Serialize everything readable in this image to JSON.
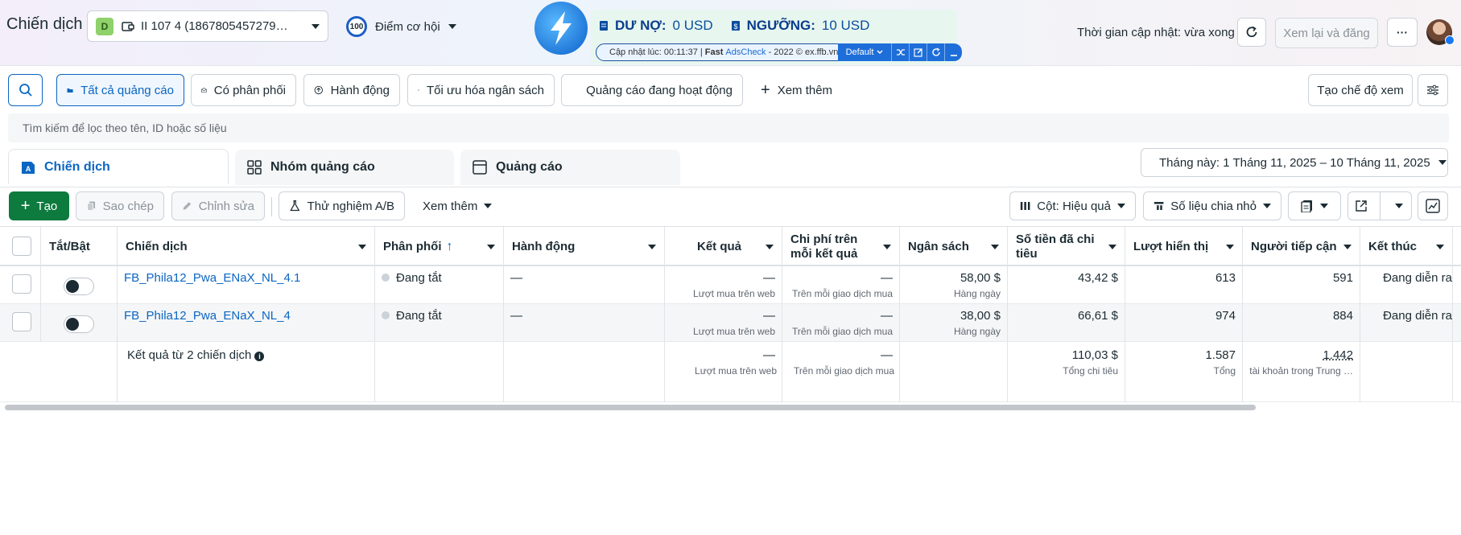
{
  "header": {
    "title": "Chiến dịch",
    "account_badge": "D",
    "account_name": "II 107 4 (1867805457279…",
    "opportunity_score": "100",
    "opportunity_label": "Điểm cơ hội",
    "update_time": "Thời gian cập nhật: vừa xong",
    "review_publish": "Xem lại và đăng",
    "more": "···"
  },
  "extension": {
    "debt_label": "DƯ NỢ:",
    "debt_value": "0 USD",
    "threshold_label": "NGƯỠNG:",
    "threshold_value": "10 USD",
    "updated_prefix": "Cập nhật lúc: 00:11:37 |",
    "fast": "Fast",
    "adscheck": "AdsCheck",
    "copyright": "- 2022 © ex.ffb.vn",
    "mode": "Default"
  },
  "filters": {
    "all_ads": "Tất cả quảng cáo",
    "has_delivery": "Có phân phối",
    "actions": "Hành động",
    "budget_opt": "Tối ưu hóa ngân sách",
    "active_ads": "Quảng cáo đang hoạt động",
    "see_more": "Xem thêm",
    "create_view": "Tạo chế độ xem"
  },
  "search": {
    "placeholder": "Tìm kiếm để lọc theo tên, ID hoặc số liệu"
  },
  "tabs": {
    "campaigns": "Chiến dịch",
    "adsets": "Nhóm quảng cáo",
    "ads": "Quảng cáo",
    "date_range": "Tháng này: 1 Tháng 11, 2025 – 10 Tháng 11, 2025"
  },
  "toolbar": {
    "create": "Tạo",
    "copy": "Sao chép",
    "edit": "Chỉnh sửa",
    "ab_test": "Thử nghiệm A/B",
    "see_more": "Xem thêm",
    "columns": "Cột: Hiệu quả",
    "breakdown": "Số liệu chia nhỏ"
  },
  "table": {
    "headers": {
      "toggle": "Tắt/Bật",
      "campaign": "Chiến dịch",
      "delivery": "Phân phối",
      "actions": "Hành động",
      "results": "Kết quả",
      "cost_per_result": "Chi phí trên mỗi kết quả",
      "budget": "Ngân sách",
      "amount_spent": "Số tiền đã chi tiêu",
      "impressions": "Lượt hiển thị",
      "reach": "Người tiếp cận",
      "ends": "Kết thúc"
    },
    "rows": [
      {
        "name": "FB_Phila12_Pwa_ENaX_NL_4.1",
        "delivery": "Đang tắt",
        "actions": "—",
        "results": "—",
        "results_sub": "Lượt mua trên web",
        "cost": "—",
        "cost_sub": "Trên mỗi giao dịch mua",
        "budget": "58,00 $",
        "budget_sub": "Hàng ngày",
        "spent": "43,42 $",
        "impressions": "613",
        "reach": "591",
        "ends": "Đang diễn ra"
      },
      {
        "name": "FB_Phila12_Pwa_ENaX_NL_4",
        "delivery": "Đang tắt",
        "actions": "—",
        "results": "—",
        "results_sub": "Lượt mua trên web",
        "cost": "—",
        "cost_sub": "Trên mỗi giao dịch mua",
        "budget": "38,00 $",
        "budget_sub": "Hàng ngày",
        "spent": "66,61 $",
        "impressions": "974",
        "reach": "884",
        "ends": "Đang diễn ra"
      }
    ],
    "summary": {
      "label": "Kết quả từ 2 chiến dịch",
      "results": "—",
      "results_sub": "Lượt mua trên web",
      "cost": "—",
      "cost_sub": "Trên mỗi giao dịch mua",
      "spent": "110,03 $",
      "spent_sub": "Tổng chi tiêu",
      "impressions": "1.587",
      "impressions_sub": "Tổng",
      "reach": "1.442",
      "reach_sub": "tài khoản trong Trung …"
    }
  }
}
